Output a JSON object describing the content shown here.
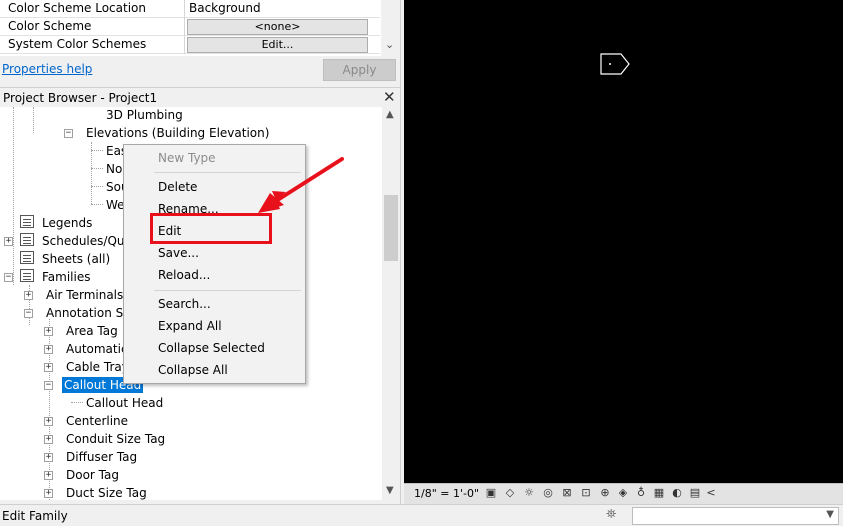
{
  "properties": {
    "rows": [
      {
        "label": "Color Scheme Location",
        "value": "Background"
      },
      {
        "label": "Color Scheme",
        "value": "<none>"
      },
      {
        "label": "System Color Schemes",
        "value": "Edit..."
      }
    ],
    "help_link": "Properties help",
    "apply_label": "Apply"
  },
  "project_browser": {
    "title": "Project Browser - Project1",
    "close_glyph": "✕",
    "tree": [
      {
        "label": "3D Plumbing"
      },
      {
        "label": "Elevations (Building Elevation)"
      },
      {
        "label": "Eas"
      },
      {
        "label": "No"
      },
      {
        "label": "Sou"
      },
      {
        "label": "We"
      },
      {
        "label": "Legends"
      },
      {
        "label": "Schedules/Qua"
      },
      {
        "label": "Sheets (all)"
      },
      {
        "label": "Families"
      },
      {
        "label": "Air Terminals"
      },
      {
        "label": "Annotation Sy"
      },
      {
        "label": "Area Tag"
      },
      {
        "label": "Automatic"
      },
      {
        "label": "Cable Tray"
      },
      {
        "label": "Callout Head"
      },
      {
        "label": "Callout Head"
      },
      {
        "label": "Centerline"
      },
      {
        "label": "Conduit Size Tag"
      },
      {
        "label": "Diffuser Tag"
      },
      {
        "label": "Door Tag"
      },
      {
        "label": "Duct Size Tag"
      }
    ]
  },
  "context_menu": {
    "items": [
      {
        "label": "New Type",
        "enabled": false
      },
      {
        "label": "Delete",
        "enabled": true
      },
      {
        "label": "Rename...",
        "enabled": true
      },
      {
        "label": "Edit",
        "enabled": true
      },
      {
        "label": "Save...",
        "enabled": true
      },
      {
        "label": "Reload...",
        "enabled": true
      },
      {
        "label": "Search...",
        "enabled": true
      },
      {
        "label": "Expand All",
        "enabled": true
      },
      {
        "label": "Collapse Selected",
        "enabled": true
      },
      {
        "label": "Collapse All",
        "enabled": true
      }
    ],
    "highlighted_item": "Edit",
    "annotation_color": "#e8101a"
  },
  "view_bar": {
    "scale": "1/8\" = 1'-0\"",
    "collapse_glyph": "<"
  },
  "status_bar": {
    "text": "Edit Family"
  },
  "colors": {
    "canvas": "#000000",
    "selection": "#0078d7",
    "link": "#0066cc"
  }
}
